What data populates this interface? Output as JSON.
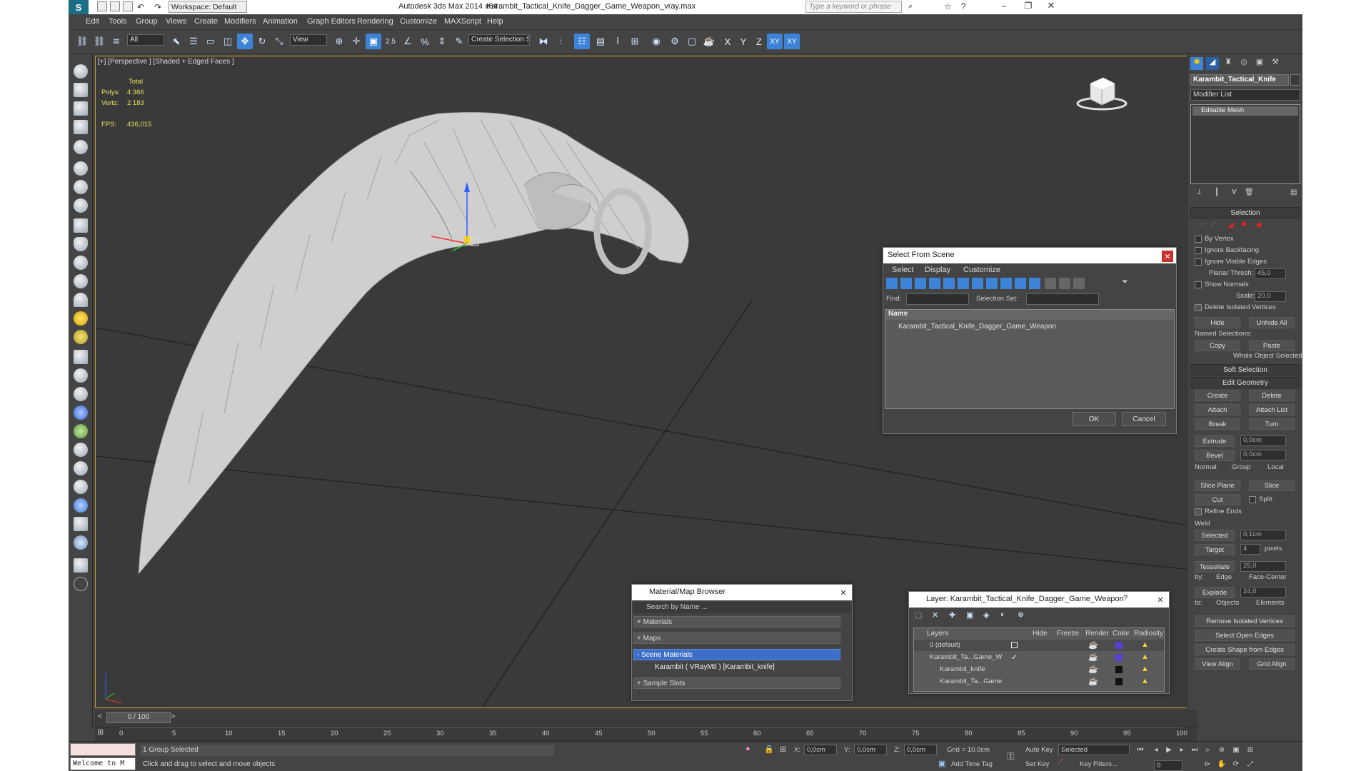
{
  "window": {
    "workspace": "Workspace: Default",
    "app_title": "Autodesk 3ds Max  2014 x64",
    "file_title": "Karambit_Tactical_Knife_Dagger_Game_Weapon_vray.max",
    "search_placeholder": "Type a keyword or phrase"
  },
  "menu": [
    "Edit",
    "Tools",
    "Group",
    "Views",
    "Create",
    "Modifiers",
    "Animation",
    "Graph Editors",
    "Rendering",
    "Customize",
    "MAXScript",
    "Help"
  ],
  "toolbar": {
    "filter": "All",
    "ref_coord": "View",
    "selection_set": "Create Selection Se",
    "snap_label": "2.5",
    "axes": [
      "X",
      "Y",
      "Z",
      "XY",
      "XY"
    ]
  },
  "viewport": {
    "label": "[+] [Perspective ] [Shaded + Edged Faces ]",
    "stats": {
      "total": "Total",
      "polys_label": "Polys:",
      "polys": "4 366",
      "verts_label": "Verts:",
      "verts": "2 183",
      "fps_label": "FPS:",
      "fps": "436,015"
    }
  },
  "command_panel": {
    "object_name": "Karambit_Tactical_Knife",
    "modifier_list": "Modifier List",
    "stack": [
      "Editable Mesh"
    ],
    "selection": {
      "title": "Selection",
      "by_vertex": "By Vertex",
      "ignore_backfacing": "Ignore Backfacing",
      "ignore_visible_edges": "Ignore Visible Edges",
      "planar_thresh": "Planar Thresh:",
      "planar_value": "45,0",
      "show_normals": "Show Normals",
      "scale": "Scale:",
      "scale_value": "20,0",
      "delete_isolated": "Delete Isolated Vertices",
      "hide": "Hide",
      "unhide_all": "Unhide All",
      "named_selections": "Named Selections:",
      "copy": "Copy",
      "paste": "Paste",
      "status": "Whole Object Selected"
    },
    "soft_selection": "Soft Selection",
    "edit_geometry": {
      "title": "Edit Geometry",
      "create": "Create",
      "delete": "Delete",
      "attach": "Attach",
      "attach_list": "Attach List",
      "break": "Break",
      "turn": "Turn",
      "extrude": "Extrude",
      "extrude_value": "0,0cm",
      "bevel": "Bevel",
      "bevel_value": "0,0cm",
      "normal": "Normal:",
      "group": "Group",
      "local": "Local",
      "slice_plane": "Slice Plane",
      "slice": "Slice",
      "cut": "Cut",
      "split": "Split",
      "refine_ends": "Refine Ends",
      "weld": "Weld",
      "selected": "Selected",
      "selected_value": "0,1cm",
      "target": "Target",
      "target_value": "4",
      "pixels": "pixels",
      "tessellate": "Tessellate",
      "tessellate_value": "25,0",
      "by": "by:",
      "edge": "Edge",
      "face_center": "Face-Center",
      "explode": "Explode",
      "explode_value": "24,0",
      "to": "to:",
      "objects": "Objects",
      "elements": "Elements",
      "remove_isolated": "Remove Isolated Vertices",
      "select_open_edges": "Select Open Edges",
      "create_shape": "Create Shape from Edges",
      "view_align": "View Align",
      "grid_align": "Grid Align"
    }
  },
  "select_from_scene": {
    "title": "Select From Scene",
    "menu": [
      "Select",
      "Display",
      "Customize"
    ],
    "find": "Find:",
    "selection_set": "Selection Set:",
    "column_name": "Name",
    "items": [
      "Karambit_Tactical_Knife_Dagger_Game_Weapon"
    ],
    "ok": "OK",
    "cancel": "Cancel"
  },
  "material_browser": {
    "title": "Material/Map Browser",
    "search_placeholder": "Search by Name ...",
    "groups": [
      "+ Materials",
      "+ Maps",
      "- Scene Materials"
    ],
    "scene_item": "Karambit  ( VRayMtl )  [Karambit_knife]",
    "sample_slots": "+ Sample Slots"
  },
  "layer_dialog": {
    "title": "Layer: Karambit_Tactical_Knife_Dagger_Game_Weapon",
    "columns": [
      "Layers",
      "Hide",
      "Freeze",
      "Render",
      "Color",
      "Radiosity"
    ],
    "rows": [
      {
        "name": "0 (default)",
        "color": "#5a3fd6"
      },
      {
        "name": "Karambit_Ta...Game_W",
        "color": "#5a3fd6"
      },
      {
        "name": "Karambit_knife",
        "color": "#101010"
      },
      {
        "name": "Karambit_Ta...Game",
        "color": "#101010"
      }
    ]
  },
  "timeline": {
    "frame": "0 / 100",
    "ticks": [
      "0",
      "5",
      "10",
      "15",
      "20",
      "25",
      "30",
      "35",
      "40",
      "45",
      "50",
      "55",
      "60",
      "65",
      "70",
      "75",
      "80",
      "85",
      "90",
      "95",
      "100"
    ]
  },
  "status": {
    "maxscript": "Welcome to M",
    "selected": "1 Group Selected",
    "prompt": "Click and drag to select and move objects",
    "x_label": "X:",
    "x": "0,0cm",
    "y_label": "Y:",
    "y": "0,0cm",
    "z_label": "Z:",
    "z": "0,0cm",
    "grid": "Grid = 10,0cm",
    "add_time_tag": "Add Time Tag",
    "auto_key": "Auto Key",
    "auto_key_value": "Selected",
    "set_key": "Set Key",
    "key_filters": "Key Filters...",
    "frame_field": "0"
  }
}
